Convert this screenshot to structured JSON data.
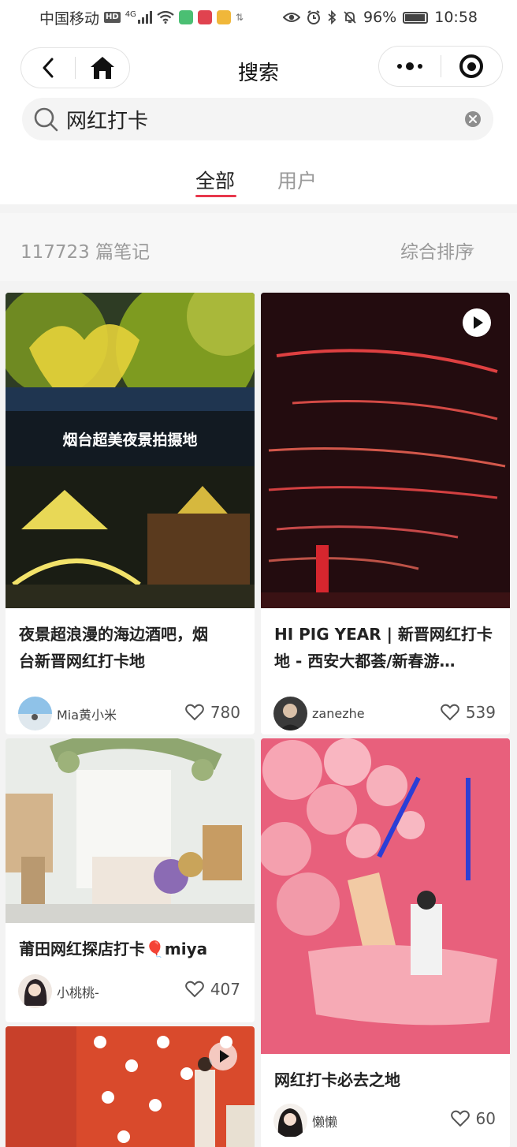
{
  "status_bar": {
    "carrier": "中国移动",
    "hd": "HD",
    "network": "4G",
    "battery": "96%",
    "battery_level": 0.96,
    "time": "10:58"
  },
  "nav": {
    "title": "搜索"
  },
  "search": {
    "query": "网红打卡"
  },
  "tabs": [
    {
      "label": "全部",
      "active": true
    },
    {
      "label": "用户",
      "active": false
    }
  ],
  "results": {
    "count_label": "117723 篇笔记",
    "sort_label": "综合排序"
  },
  "feed": {
    "cards": [
      {
        "title": "夜景超浪漫的海边酒吧，烟\n台新晋网红打卡地",
        "author": "Mia黄小米",
        "likes": "780",
        "is_video": false,
        "image_caption": "烟台超美夜景拍摄地"
      },
      {
        "title": "HI PIG YEAR | 新晋网红打卡\n地 - 西安大都荟/新春游…",
        "author": "zanezhe",
        "likes": "539",
        "is_video": true
      },
      {
        "title": "莆田网红探店打卡🎈miya",
        "author": "小桃桃-",
        "likes": "407",
        "is_video": false
      },
      {
        "title": "网红打卡必去之地",
        "author": "懒懒",
        "likes": "60",
        "is_video": false
      },
      {
        "is_video": true
      }
    ]
  },
  "colors": {
    "accent": "#e8374c",
    "muted_text": "#9a9a9a",
    "page_bg": "#f3f3f3"
  }
}
